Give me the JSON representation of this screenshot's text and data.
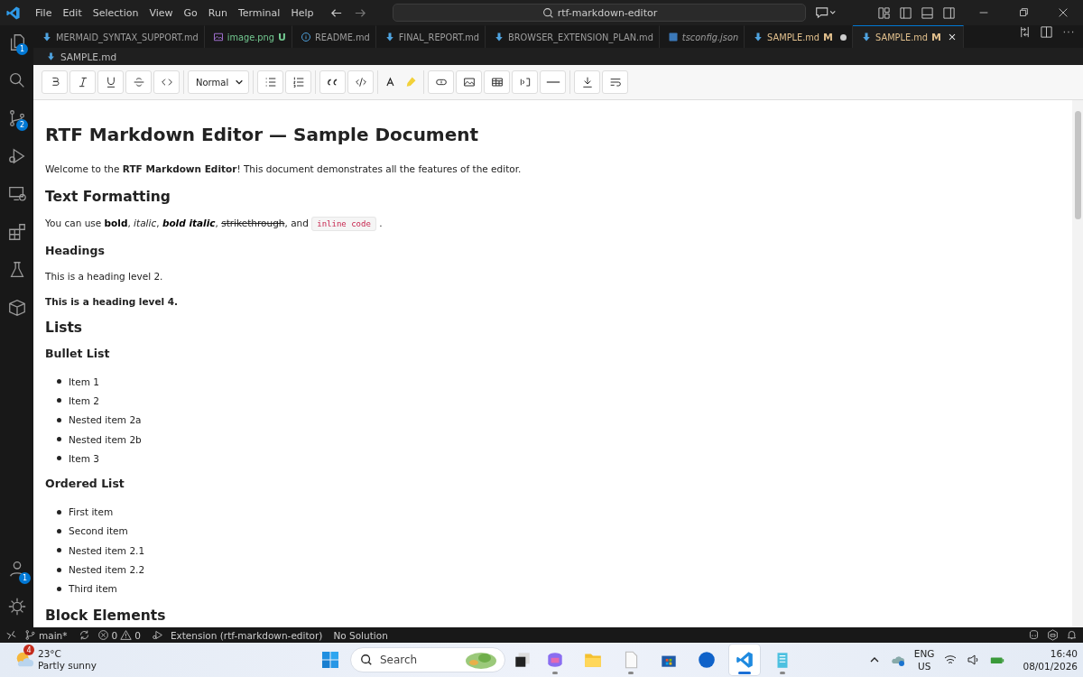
{
  "title_bar": {
    "menu": [
      "File",
      "Edit",
      "Selection",
      "View",
      "Go",
      "Run",
      "Terminal",
      "Help"
    ],
    "search": "rtf-markdown-editor"
  },
  "activity_bar": {
    "top": [
      {
        "kind": "explorer",
        "badge": "1"
      },
      {
        "kind": "search"
      },
      {
        "kind": "source_control",
        "badge": "2"
      },
      {
        "kind": "run"
      },
      {
        "kind": "remote"
      },
      {
        "kind": "extensions"
      },
      {
        "kind": "testing"
      },
      {
        "kind": "package"
      }
    ],
    "bottom": [
      {
        "kind": "account",
        "badge": "1"
      },
      {
        "kind": "settings"
      }
    ]
  },
  "tabs": [
    {
      "label": "MERMAID_SYNTAX_SUPPORT.md",
      "kind": "markdown",
      "selected": false
    },
    {
      "label": "image.png",
      "kind": "image",
      "git": "U",
      "color": "#73c991",
      "selected": false
    },
    {
      "label": "README.md",
      "kind": "info",
      "selected": false
    },
    {
      "label": "FINAL_REPORT.md",
      "kind": "markdown",
      "selected": false
    },
    {
      "label": "BROWSER_EXTENSION_PLAN.md",
      "kind": "markdown",
      "selected": false
    },
    {
      "label": "tsconfig.json",
      "kind": "typescript",
      "preview": true,
      "selected": false
    },
    {
      "label": "SAMPLE.md",
      "kind": "markdown",
      "git": "M",
      "color": "#e2c08d",
      "dirty": true,
      "selected": false
    },
    {
      "label": "SAMPLE.md",
      "kind": "markdown",
      "git": "M",
      "color": "#e2c08d",
      "selected": true
    }
  ],
  "editor": {
    "breadcrumb": "SAMPLE.md",
    "toolbar": [
      [
        {
          "kind": "bold"
        },
        {
          "kind": "italic"
        },
        {
          "kind": "underline"
        },
        {
          "kind": "strike"
        },
        {
          "kind": "code"
        }
      ],
      [
        {
          "kind": "select",
          "value": "Normal"
        }
      ],
      [
        {
          "kind": "bullet"
        },
        {
          "kind": "ordered"
        }
      ],
      [
        {
          "kind": "quote"
        },
        {
          "kind": "codeblock"
        }
      ],
      [
        {
          "kind": "textcolor"
        },
        {
          "kind": "highlight"
        }
      ],
      [
        {
          "kind": "link"
        },
        {
          "kind": "image"
        },
        {
          "kind": "table"
        },
        {
          "kind": "bracket"
        },
        {
          "kind": "rule"
        }
      ],
      [
        {
          "kind": "download"
        },
        {
          "kind": "wrap"
        }
      ]
    ],
    "document": [
      {
        "kind": "h1",
        "text": "RTF Markdown Editor — Sample Document"
      },
      {
        "kind": "p",
        "text": "Welcome to the **RTF Markdown Editor**! This document demonstrates all the features of the editor."
      },
      {
        "kind": "h2",
        "text": "Text Formatting"
      },
      {
        "kind": "runs",
        "runs": [
          {
            "kind": "plain",
            "text": "You can use "
          },
          {
            "kind": "bold",
            "text": "bold"
          },
          {
            "kind": "plain",
            "text": ", "
          },
          {
            "kind": "italic",
            "text": "italic"
          },
          {
            "kind": "plain",
            "text": ", "
          },
          {
            "kind": "bold_italic",
            "text": "bold italic"
          },
          {
            "kind": "plain",
            "text": ", "
          },
          {
            "kind": "strike",
            "text": "strikethrough"
          },
          {
            "kind": "plain",
            "text": ", and "
          },
          {
            "kind": "code",
            "text": "inline code"
          },
          {
            "kind": "plain",
            "text": " ."
          }
        ]
      },
      {
        "kind": "h3",
        "text": "Headings"
      },
      {
        "kind": "p",
        "text": "This is a heading level 2."
      },
      {
        "kind": "h4",
        "text": "This is a heading level 4."
      },
      {
        "kind": "h2",
        "text": "Lists"
      },
      {
        "kind": "h3",
        "text": "Bullet List"
      },
      {
        "kind": "list",
        "items": [
          "Item 1",
          "Item 2",
          "Nested item 2a",
          "Nested item 2b",
          "Item 3"
        ]
      },
      {
        "kind": "h3",
        "text": "Ordered List"
      },
      {
        "kind": "list",
        "items": [
          "First item",
          "Second item",
          "Nested item 2.1",
          "Nested item 2.2",
          "Third item"
        ]
      },
      {
        "kind": "h2",
        "text": "Block Elements"
      }
    ]
  },
  "status_bar": {
    "branch": "main*",
    "errors": "0",
    "warnings": "0",
    "items": [
      "Extension (rtf-markdown-editor)",
      "No Solution"
    ]
  },
  "taskbar": {
    "weather": {
      "badge": "4",
      "temp": "23°C",
      "condition": "Partly sunny"
    },
    "search": "Search",
    "apps": [
      {
        "kind": "copilot",
        "running": true,
        "selected": false
      },
      {
        "kind": "folder",
        "running": false,
        "selected": false
      },
      {
        "kind": "file",
        "running": true,
        "selected": false
      },
      {
        "kind": "store",
        "running": false,
        "selected": false
      },
      {
        "kind": "hp",
        "running": false,
        "selected": false
      },
      {
        "kind": "vscode",
        "running": true,
        "selected": true
      },
      {
        "kind": "notepad",
        "running": true,
        "selected": false
      }
    ],
    "language": [
      "ENG",
      "US"
    ],
    "time": "16:40",
    "date": "08/01/2026"
  }
}
